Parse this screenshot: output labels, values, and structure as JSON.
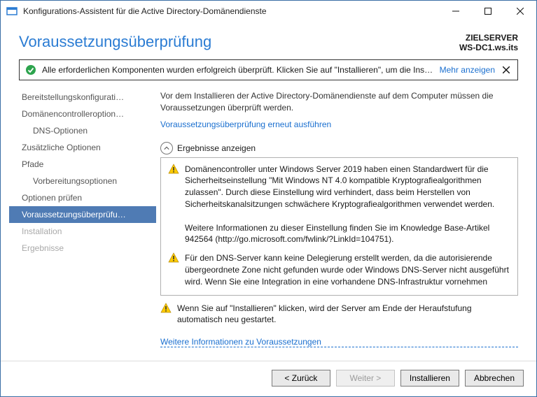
{
  "window": {
    "title": "Konfigurations-Assistent für die Active Directory-Domänendienste"
  },
  "header": {
    "title": "Voraussetzungsüberprüfung",
    "target_label": "ZIELSERVER",
    "target_value": "WS-DC1.ws.its"
  },
  "banner": {
    "message": "Alle erforderlichen Komponenten wurden erfolgreich überprüft. Klicken Sie auf \"Installieren\", um die Inst…",
    "more": "Mehr anzeigen"
  },
  "sidebar": {
    "items": [
      {
        "label": "Bereitstellungskonfigurati…",
        "indent": false,
        "state": "normal"
      },
      {
        "label": "Domänencontrolleroption…",
        "indent": false,
        "state": "normal"
      },
      {
        "label": "DNS-Optionen",
        "indent": true,
        "state": "normal"
      },
      {
        "label": "Zusätzliche Optionen",
        "indent": false,
        "state": "normal"
      },
      {
        "label": "Pfade",
        "indent": false,
        "state": "normal"
      },
      {
        "label": "Vorbereitungsoptionen",
        "indent": true,
        "state": "normal"
      },
      {
        "label": "Optionen prüfen",
        "indent": false,
        "state": "normal"
      },
      {
        "label": "Voraussetzungsüberprüfu…",
        "indent": false,
        "state": "active"
      },
      {
        "label": "Installation",
        "indent": false,
        "state": "disabled"
      },
      {
        "label": "Ergebnisse",
        "indent": false,
        "state": "disabled"
      }
    ]
  },
  "main": {
    "intro": "Vor dem Installieren der Active Directory-Domänendienste auf dem Computer müssen die Voraussetzungen überprüft werden.",
    "rerun": "Voraussetzungsüberprüfung erneut ausführen",
    "toggle": "Ergebnisse anzeigen",
    "results": [
      {
        "icon": "warn",
        "text": "Domänencontroller unter Windows Server 2019 haben einen Standardwert für die Sicherheitseinstellung \"Mit Windows NT 4.0 kompatible Kryptografiealgorithmen zulassen\". Durch diese Einstellung wird verhindert, dass beim Herstellen von Sicherheitskanalsitzungen schwächere Kryptografiealgorithmen verwendet werden.\n\nWeitere Informationen zu dieser Einstellung finden Sie im Knowledge Base-Artikel 942564 (http://go.microsoft.com/fwlink/?LinkId=104751)."
      },
      {
        "icon": "warn",
        "text": "Für den DNS-Server kann keine Delegierung erstellt werden, da die autorisierende übergeordnete Zone nicht gefunden wurde oder Windows DNS-Server nicht ausgeführt wird. Wenn Sie eine Integration in eine vorhandene DNS-Infrastruktur vornehmen"
      }
    ],
    "footer_note": "Wenn Sie auf \"Installieren\" klicken, wird der Server am Ende der Heraufstufung automatisch neu gestartet.",
    "more_info": "Weitere Informationen zu Voraussetzungen"
  },
  "buttons": {
    "back": "< Zurück",
    "next": "Weiter >",
    "install": "Installieren",
    "cancel": "Abbrechen"
  }
}
